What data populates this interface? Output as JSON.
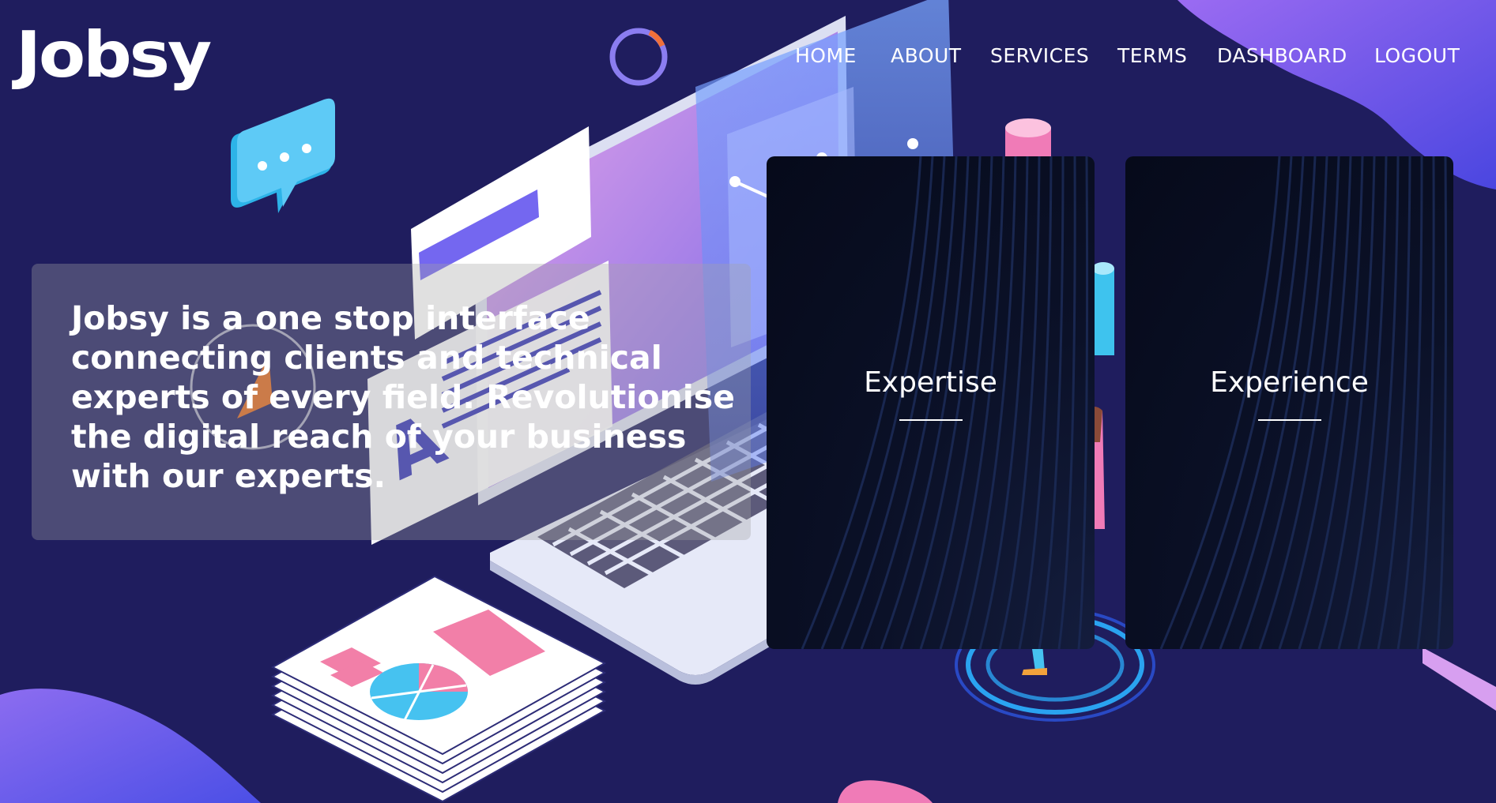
{
  "brand": {
    "logo_text": "Jobsy"
  },
  "nav": {
    "items": [
      {
        "label": "HOME"
      },
      {
        "label": "ABOUT"
      },
      {
        "label": "SERVICES"
      },
      {
        "label": "TERMS"
      },
      {
        "label": "DASHBOARD"
      },
      {
        "label": "LOGOUT"
      }
    ]
  },
  "hero": {
    "text": "Jobsy is a one stop interface connecting clients and technical experts of every field. Revolutionise the digital reach of your business with our experts."
  },
  "cards": [
    {
      "title": "Expertise"
    },
    {
      "title": "Experience"
    }
  ],
  "colors": {
    "background": "#1f1d5e",
    "accent_purple": "#8a5cf5",
    "accent_pink": "#f06fa3",
    "accent_cyan": "#46c2f0",
    "card_bg": "#070b1c"
  }
}
